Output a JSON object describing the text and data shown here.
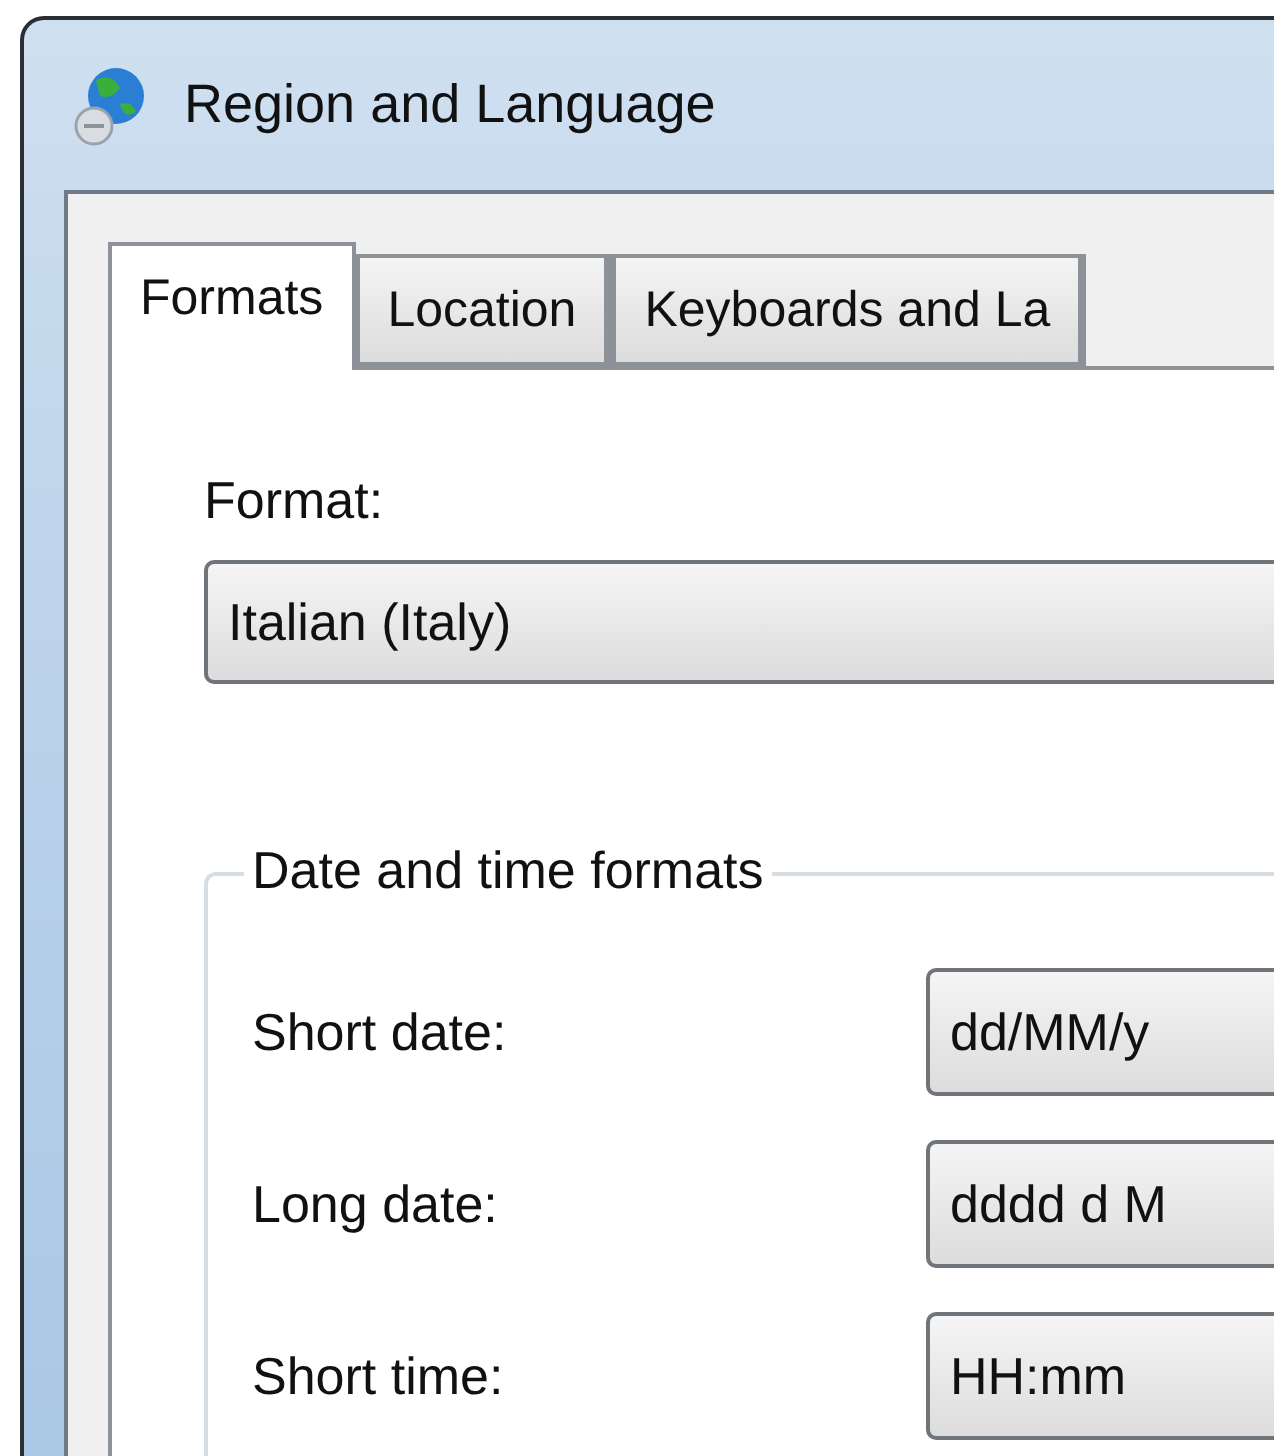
{
  "window": {
    "title": "Region and Language"
  },
  "tabs": [
    {
      "label": "Formats",
      "selected": true
    },
    {
      "label": "Location",
      "selected": false
    },
    {
      "label": "Keyboards and La",
      "selected": false
    }
  ],
  "format": {
    "label": "Format:",
    "value": "Italian (Italy)"
  },
  "date_time_formats": {
    "title": "Date and time formats",
    "rows": [
      {
        "label": "Short date:",
        "value": "dd/MM/y"
      },
      {
        "label": "Long date:",
        "value": "dddd d M"
      },
      {
        "label": "Short time:",
        "value": "HH:mm"
      }
    ]
  }
}
